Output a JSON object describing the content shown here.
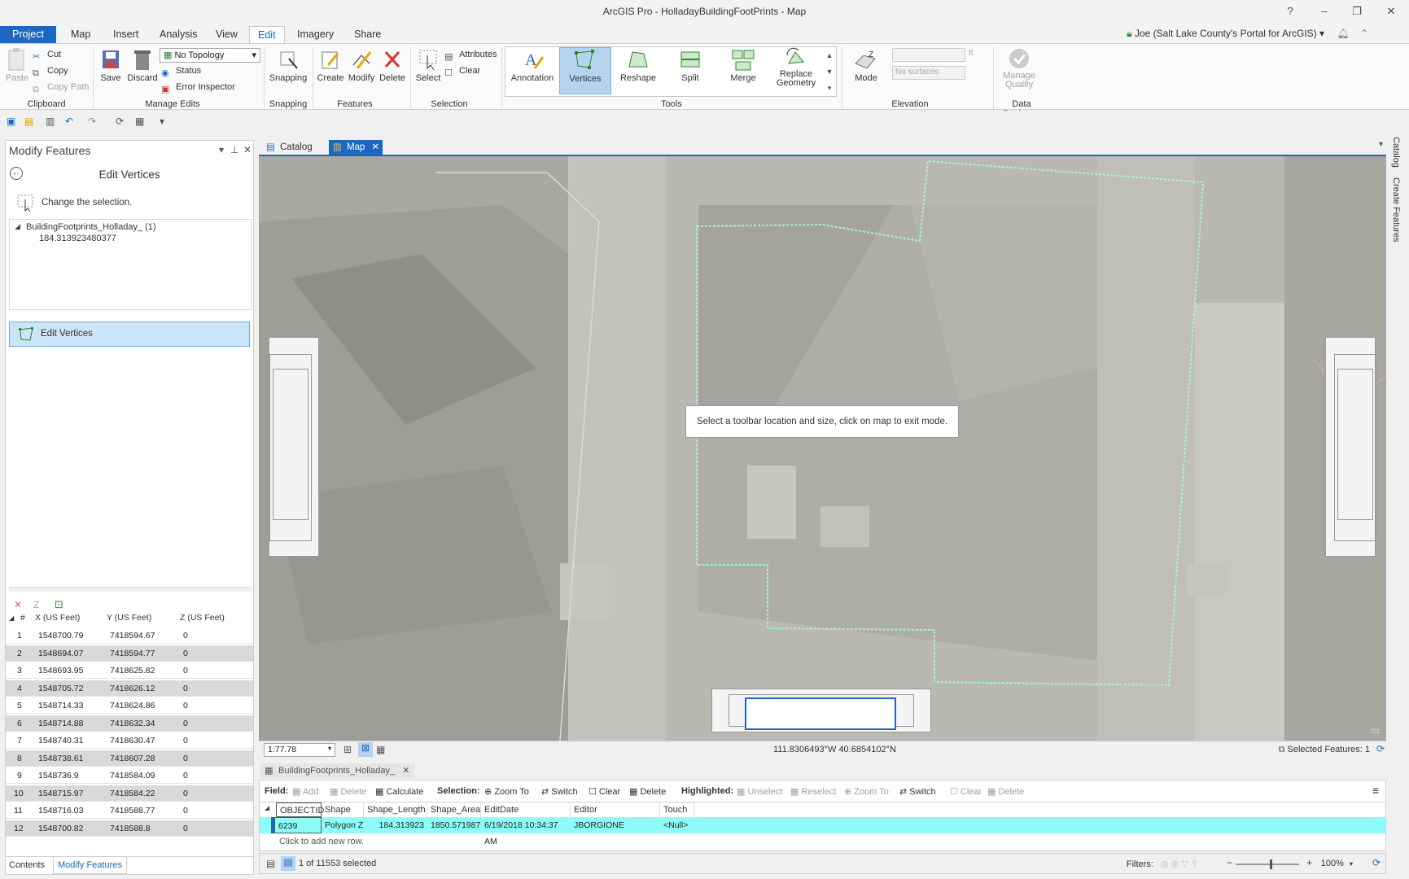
{
  "window": {
    "title": "ArcGIS Pro - HolladayBuildingFootPrints - Map",
    "help": "?",
    "minimize": "–",
    "restore": "❐",
    "close": "✕"
  },
  "tabs": [
    "Project",
    "Map",
    "Insert",
    "Analysis",
    "View",
    "Edit",
    "Imagery",
    "Share"
  ],
  "active_tab": "Edit",
  "account": "Joe (Salt Lake County's Portal for ArcGIS) ▾",
  "ribbon": {
    "clipboard": {
      "paste": "Paste",
      "cut": "Cut",
      "copy": "Copy",
      "copy_path": "Copy Path",
      "label": "Clipboard"
    },
    "manage_edits": {
      "save": "Save",
      "discard": "Discard",
      "topology": "No Topology",
      "status": "Status",
      "error_inspector": "Error Inspector",
      "label": "Manage Edits"
    },
    "snapping": {
      "snapping": "Snapping",
      "label": "Snapping"
    },
    "features": {
      "create": "Create",
      "modify": "Modify",
      "delete": "Delete",
      "label": "Features"
    },
    "selection": {
      "select": "Select",
      "attributes": "Attributes",
      "clear": "Clear",
      "label": "Selection"
    },
    "tools": {
      "annotation": "Annotation",
      "vertices": "Vertices",
      "reshape": "Reshape",
      "split": "Split",
      "merge": "Merge",
      "replace_geometry": "Replace Geometry",
      "label": "Tools"
    },
    "elevation": {
      "mode": "Mode",
      "surface": "No surfaces",
      "unit": "ft",
      "label": "Elevation"
    },
    "data_reviewer": {
      "manage_quality": "Manage Quality",
      "label": "Data Reviewer"
    }
  },
  "left_pane": {
    "title": "Modify Features",
    "subtitle": "Edit Vertices",
    "change_selection": "Change the selection.",
    "layer": "BuildingFootprints_Holladay_ (1)",
    "feature": "184.313923480377",
    "tool_button": "Edit Vertices",
    "columns": [
      "#",
      "X (US Feet)",
      "Y (US Feet)",
      "Z (US Feet)"
    ],
    "vertices": [
      [
        "1",
        "1548700.79",
        "7418594.67",
        "0"
      ],
      [
        "2",
        "1548694.07",
        "7418594.77",
        "0"
      ],
      [
        "3",
        "1548693.95",
        "7418625.82",
        "0"
      ],
      [
        "4",
        "1548705.72",
        "7418626.12",
        "0"
      ],
      [
        "5",
        "1548714.33",
        "7418624.86",
        "0"
      ],
      [
        "6",
        "1548714.88",
        "7418632.34",
        "0"
      ],
      [
        "7",
        "1548740.31",
        "7418630.47",
        "0"
      ],
      [
        "8",
        "1548738.61",
        "7418607.28",
        "0"
      ],
      [
        "9",
        "1548736.9",
        "7418584.09",
        "0"
      ],
      [
        "10",
        "1548715.97",
        "7418584.22",
        "0"
      ],
      [
        "11",
        "1548716.03",
        "7418588.77",
        "0"
      ],
      [
        "12",
        "1548700.82",
        "7418588.8",
        "0"
      ]
    ],
    "bottom_tabs": [
      "Contents",
      "Modify Features"
    ]
  },
  "right_dock": [
    "Catalog",
    "Create Features"
  ],
  "map_tabs": [
    "Catalog",
    "Map"
  ],
  "map": {
    "message": "Select a toolbar location and size, click on map to exit mode.",
    "scale": "1:77.78",
    "coordinates": "111.8306493°W 40.6854102°N",
    "selected_features": "Selected Features: 1"
  },
  "attribute_table": {
    "tab": "BuildingFootprints_Holladay_",
    "toolbar": {
      "field": "Field:",
      "add": "Add",
      "delete": "Delete",
      "calculate": "Calculate",
      "selection": "Selection:",
      "zoom_to": "Zoom To",
      "switch": "Switch",
      "clear": "Clear",
      "sel_delete": "Delete",
      "highlighted": "Highlighted:",
      "unselect": "Unselect",
      "reselect": "Reselect",
      "h_zoom_to": "Zoom To",
      "h_switch": "Switch",
      "h_clear": "Clear",
      "h_delete": "Delete"
    },
    "columns": [
      "OBJECTID",
      "Shape",
      "Shape_Length",
      "Shape_Area",
      "EditDate",
      "Editor",
      "Touch"
    ],
    "row": [
      "6239",
      "Polygon Z",
      "184.313923",
      "1850.571987",
      "6/19/2018 10:34:37 AM",
      "JBORGIONE",
      "<Null>"
    ],
    "add_row": "Click to add new row.",
    "selected_count": "1 of 11553 selected",
    "filters": "Filters:",
    "zoom": "100%"
  }
}
